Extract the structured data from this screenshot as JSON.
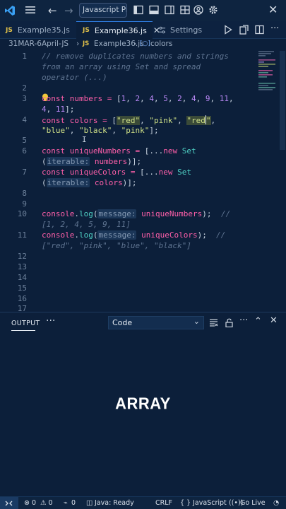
{
  "titlebar": {
    "search_text": "Javascript Prac",
    "close_glyph": "✕",
    "back_glyph": "←",
    "forward_glyph": "→"
  },
  "tabs": [
    {
      "badge": "JS",
      "label": "Example35.js"
    },
    {
      "badge": "JS",
      "label": "Example36.js",
      "close": "✕"
    },
    {
      "label": "Settings"
    }
  ],
  "breadcrumb": {
    "folder": "31MAR-6April-JS",
    "sep": "›",
    "file_badge": "JS",
    "file": "Example36.js",
    "symbol": "colors"
  },
  "editor": {
    "line_numbers": [
      "1",
      "2",
      "3",
      "4",
      "5",
      "6",
      "7",
      "8",
      "9",
      "10",
      "11",
      "12",
      "13",
      "14",
      "15",
      "16",
      "17"
    ],
    "code": {
      "l1a": "// remove duplicates numbers and strings",
      "l1b": "from an array using Set and spread",
      "l1c": "operator (...)",
      "const": "const",
      "numbers": "numbers",
      "eq": " = ",
      "lb": "[",
      "rb": "]",
      "semi": ";",
      "n1": "1",
      "n2": "2",
      "n4": "4",
      "n5": "5",
      "n9": "9",
      "n11": "11",
      "comma": ", ",
      "colors": "colors",
      "s_red": "\"red\"",
      "s_pink": "\"pink\"",
      "s_red2a": "\"red",
      "s_red2b": "\"",
      "s_blue": "\"blue\"",
      "s_black": "\"black\"",
      "uniqueNumbers": "uniqueNumbers",
      "uniqueColors": "uniqueColors",
      "spread": "[...",
      "new": "new",
      "Set": "Set",
      "lp": "(",
      "rp": ")",
      "hint_iterable": "iterable:",
      "console": "console",
      "dot": ".",
      "log": "log",
      "hint_message": "message:",
      "out_nums": "// [1, 2, 4, 5, 9, 11]",
      "out_colors": "// [\"red\", \"pink\", \"blue\", \"black\"]"
    }
  },
  "panel": {
    "tab_label": "OUTPUT",
    "more": "···",
    "channel": "Code",
    "caption": "ARRAY"
  },
  "statusbar": {
    "errors": "⊗ 0",
    "warnings": "⚠ 0",
    "ports": "0",
    "java": "Java: Ready",
    "eol": "CRLF",
    "language": "{ } JavaScript",
    "golive": "Go Live"
  },
  "colors": {
    "background": "#0c1f3a",
    "keyword": "#ff5fa9",
    "string": "#cfe087",
    "number": "#b988f5",
    "function": "#4fd1c5",
    "comment": "#5f7491"
  }
}
